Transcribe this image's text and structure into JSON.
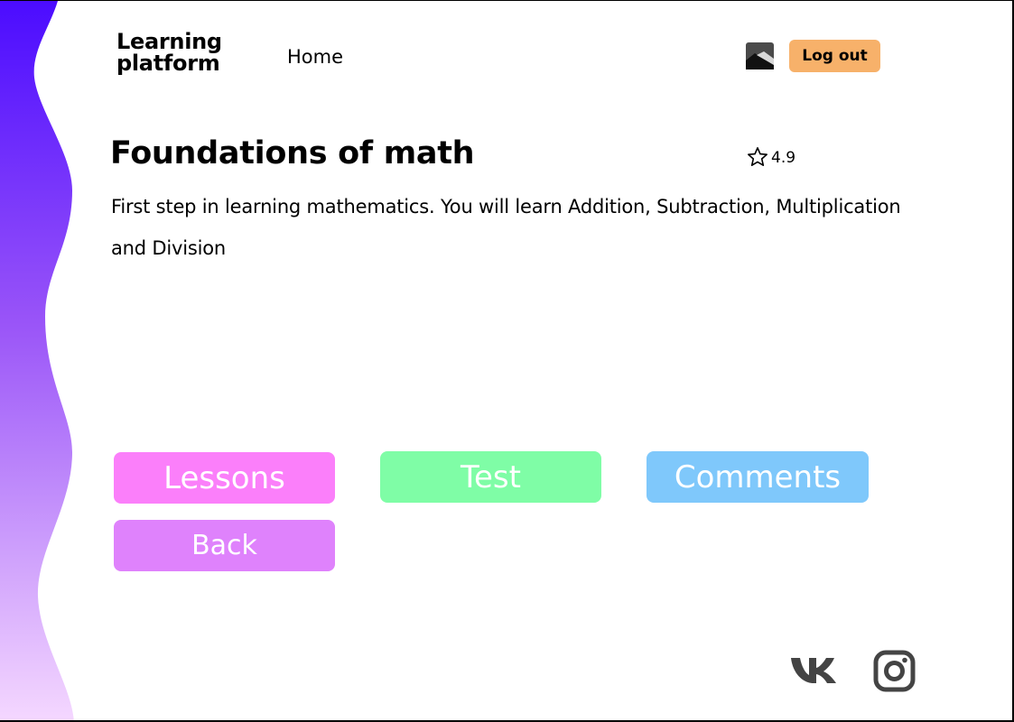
{
  "header": {
    "logo_line1": "Learning",
    "logo_line2": "platform",
    "nav_home": "Home",
    "logout_label": "Log out"
  },
  "course": {
    "title": "Foundations of math",
    "rating": "4.9",
    "description": "First step in learning mathematics. You will learn Addition, Subtraction, Multiplication and Division"
  },
  "buttons": {
    "lessons": "Lessons",
    "test": "Test",
    "comments": "Comments",
    "back": "Back"
  },
  "colors": {
    "logout": "#f7b16a",
    "lessons": "#fb7ffa",
    "test": "#7ffda6",
    "comments": "#7fc8fb",
    "back": "#df82fc",
    "wave_top": "#4b0cff",
    "wave_bottom": "#f5d8ff"
  },
  "icons": {
    "avatar": "image-placeholder-icon",
    "rating": "star-outline-icon",
    "vk": "vk-logo-icon",
    "instagram": "instagram-logo-icon"
  }
}
